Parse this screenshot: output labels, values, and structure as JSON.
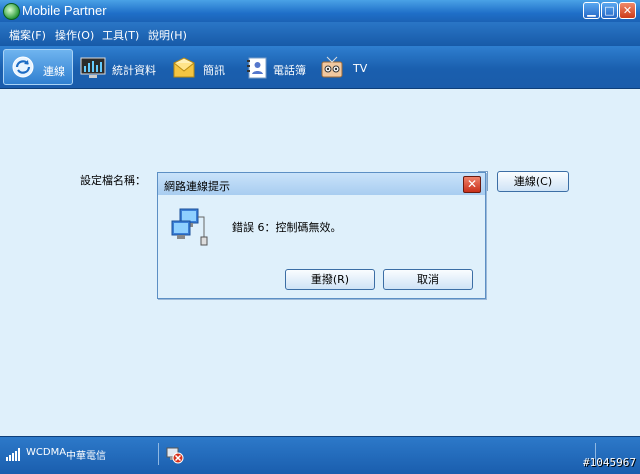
{
  "window": {
    "title": "Mobile Partner"
  },
  "menu": {
    "items": [
      "檔案(F)",
      "操作(O)",
      "工具(T)",
      "說明(H)"
    ]
  },
  "toolbar": {
    "items": [
      "連線",
      "統計資料",
      "簡訊",
      "電話簿",
      "TV"
    ],
    "active": "連線"
  },
  "main": {
    "profile_label": "設定檔名稱：",
    "connect_button": "連線(C)"
  },
  "dialog": {
    "title": "網路連線提示",
    "message": "錯誤 6：控制碼無效。",
    "retry_button": "重撥(R)",
    "cancel_button": "取消"
  },
  "statusbar": {
    "network": "WCDMA",
    "carrier": "中華電信"
  },
  "watermark": "#1045967",
  "colors": {
    "titlebar": "#1f6fc8",
    "background": "#dff0fb",
    "close": "#cc3b1a"
  }
}
